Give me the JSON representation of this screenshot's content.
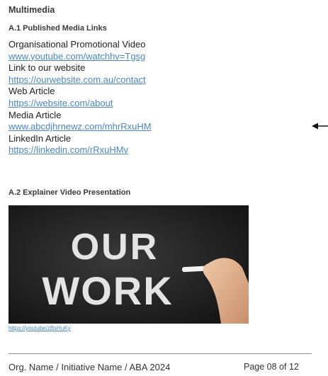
{
  "section": {
    "title": "Multimedia"
  },
  "published": {
    "heading": "A.1 Published Media Links",
    "items": [
      {
        "label": "Organisational Promotional Video",
        "url": "www.youtube.com/watchhv=Tgsg"
      },
      {
        "label": "Link to our website",
        "url": "https://ourwebsite.com.au/contact"
      },
      {
        "label": "Web Article",
        "url": "https://website.com/about"
      },
      {
        "label": "Media Article",
        "url": "www.abcdjhrnewz.com/mhrRxuHM "
      },
      {
        "label": "LinkedIn Article",
        "url": "https://linkedin.com/rRxuHMv"
      }
    ]
  },
  "explainer": {
    "heading": "A.2 Explainer Video Presentation",
    "image_text_line1": "OUR",
    "image_text_line2": "WORK",
    "video_url": "https://youtube/zBsHuKy"
  },
  "footer": {
    "document": "Org. Name / Initiative Name / ABA 2024",
    "page": "Page 08 of 12"
  },
  "colors": {
    "link": "#4a86c5",
    "text": "#2b2b2b",
    "chalkboard": "#1f1f1f"
  },
  "icons": [
    "left-arrow-icon"
  ]
}
